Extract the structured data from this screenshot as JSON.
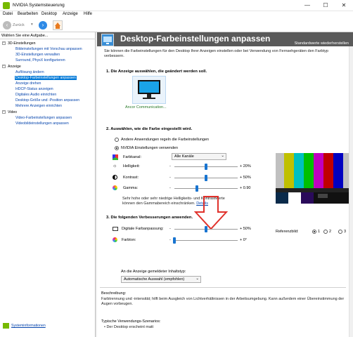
{
  "window": {
    "title": "NVIDIA Systemsteuerung",
    "minimize": "—",
    "maximize": "☐",
    "close": "✕"
  },
  "menu": [
    "Datei",
    "Bearbeiten",
    "Desktop",
    "Anzeige",
    "Hilfe"
  ],
  "toolbar": {
    "back_label": "Zurück",
    "dropdown": "▾"
  },
  "sidebar": {
    "header": "Wählen Sie eine Aufgabe...",
    "groups": [
      {
        "label": "3D-Einstellungen",
        "items": [
          "Bildeinstellungen mit Vorschau anpassen",
          "3D-Einstellungen verwalten",
          "Surround, PhysX konfigurieren"
        ]
      },
      {
        "label": "Anzeige",
        "items": [
          "Auflösung ändern",
          "Desktop-Farbeinstellungen anpassen",
          "Anzeige drehen",
          "HDCP-Status anzeigen",
          "Digitales Audio einrichten",
          "Desktop-Größe und -Position anpassen",
          "Mehrere Anzeigen einrichten"
        ]
      },
      {
        "label": "Video",
        "items": [
          "Video-Farbeinstellungen anpassen",
          "Videobildeinstellungen anpassen"
        ]
      }
    ],
    "selected_index": 1,
    "sysinfo": "Systeminformationen"
  },
  "page": {
    "title": "Desktop-Farbeinstellungen anpassen",
    "restore": "Standardwerte wiederherstellen",
    "intro": "Sie können die Farbeinstellungen für den Desktop Ihrer Anzeigen einstellen oder bei Verwendung von Fernsehgeräten den Farbtyp verbessern.",
    "sec1": "1. Die Anzeige auswählen, die geändert werden soll.",
    "monitor_label": "Ancor Communication...",
    "sec2": "2. Auswählen, wie die Farbe eingestellt wird.",
    "radio_other": "Andere Anwendungen regeln die Farbeinstellungen",
    "radio_nvidia": "NVIDIA Einstellungen verwenden",
    "channel_label": "Farbkanal:",
    "channel_value": "Alle Kanäle",
    "brightness": {
      "label": "Helligkeit:",
      "value": "+ 20%",
      "level": 0.5
    },
    "contrast": {
      "label": "Kontrast:",
      "value": "+ 50%",
      "level": 0.5
    },
    "gamma": {
      "label": "Gamma:",
      "value": "+ 0.90",
      "level": 0.35
    },
    "minus": "-",
    "hint": "Sehr hohe oder sehr niedrige Helligkeits- und Kontrastwerte können den Gammabereich einschränken.",
    "hint_link": "Details",
    "sec3": "3. Die folgenden Verbesserungen anwenden.",
    "vibrance": {
      "label": "Digitale Farbanpassung:",
      "value": "+ 50%",
      "level": 0.5
    },
    "hue": {
      "label": "Farbton:",
      "value": "+ 0°",
      "level": 0.0
    },
    "ref_label": "Referenzbild:",
    "ref_opts": [
      "1",
      "2",
      "3"
    ],
    "content_type_label": "An die Anzeige gemeldeter Inhaltstyp:",
    "content_type_value": "Automatische Auswahl (empfohlen)",
    "beschreibung_label": "Beschreibung:",
    "beschreibung_text": "Farbtrennung und -intensität; hilft beim Ausgleich von Lichtverhältnissen in der Arbeitsumgebung. Kann außerdem einer Übereinstimmung der Augen vorbeugen.",
    "scenarios_label": "Typische Verwendungs-Szenarios:",
    "scenarios_item": "• Der Desktop erscheint matt"
  },
  "colors": {
    "accent": "#0078d7",
    "nvidia_green": "#76b900",
    "arrow_red": "#e0312b"
  }
}
